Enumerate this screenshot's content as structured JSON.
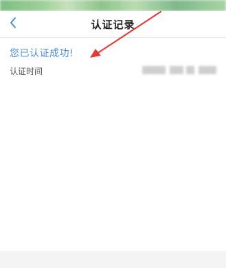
{
  "nav": {
    "title": "认证记录",
    "back_icon": "chevron-left-icon"
  },
  "record": {
    "status_text": "您已认证成功!",
    "time_label": "认证时间"
  },
  "colors": {
    "accent": "#4a90d9",
    "arrow": "#e53935"
  }
}
